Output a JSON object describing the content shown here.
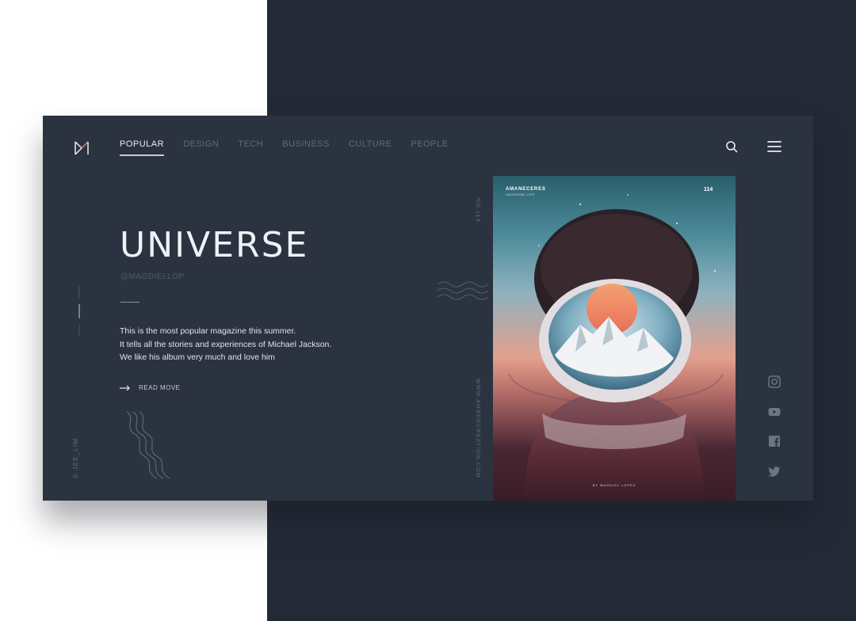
{
  "header": {
    "nav": [
      "POPULAR",
      "DESIGN",
      "TECH",
      "BUSINESS",
      "CULTURE",
      "PEOPLE"
    ],
    "active_index": 0,
    "icons": [
      "logo-icon",
      "search-icon",
      "menu-icon"
    ]
  },
  "hero": {
    "title": "UNIVERSE",
    "handle": "@MAGDIELLOP",
    "description": [
      "This is the most popular magazine this summer.",
      "It tells all the stories and experiences of Michael Jackson.",
      "We like his album very much and love him"
    ],
    "read_more": "READ MOVE"
  },
  "side": {
    "copyright": "© JEE_LIM",
    "issue": "NO.114",
    "url": "WWW.AMBERCREATION.COM"
  },
  "poster": {
    "brand": "AMANECERES",
    "brand_sub": "UNIVERSE LIFE",
    "number": "114",
    "credit": "BY MAGDIEL LOPEZ"
  },
  "social": [
    "instagram-icon",
    "youtube-icon",
    "facebook-icon",
    "twitter-icon"
  ],
  "colors": {
    "page_bg": "#ffffff",
    "panel_bg": "#232a36",
    "card_bg": "#2b3340",
    "text_primary": "#eef1f6",
    "text_muted": "#5f6a7a",
    "sun": "#f08a62"
  }
}
